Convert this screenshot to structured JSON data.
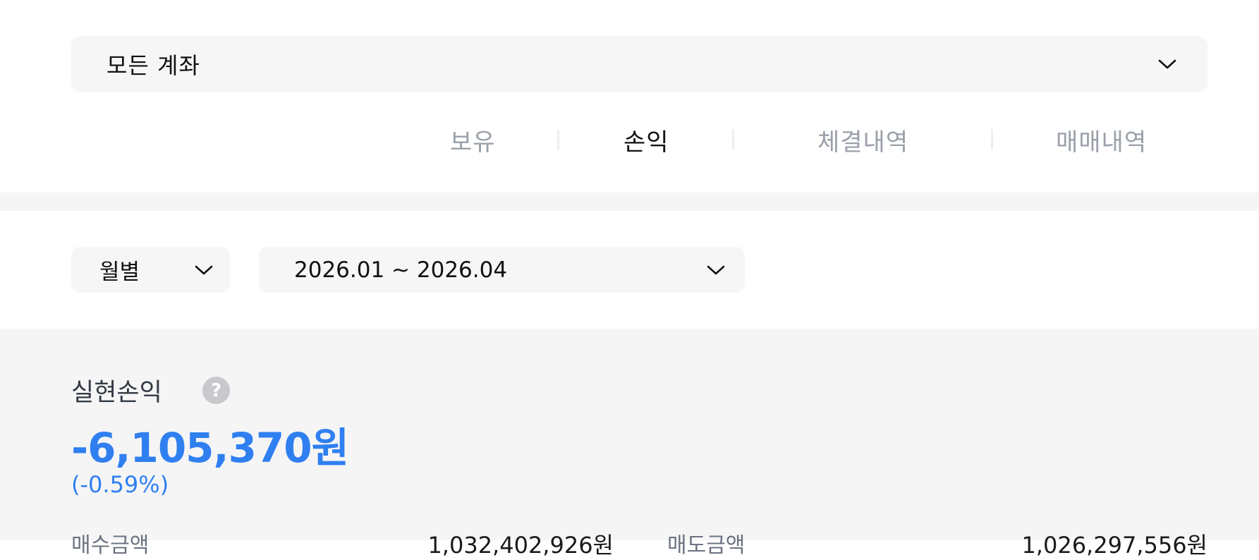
{
  "account": {
    "label": "모든 계좌"
  },
  "tabs": [
    {
      "label": "보유",
      "active": false
    },
    {
      "label": "손익",
      "active": true
    },
    {
      "label": "체결내역",
      "active": false
    },
    {
      "label": "매매내역",
      "active": false
    }
  ],
  "filters": {
    "period": "월별",
    "range": "2026.01 ~ 2026.04"
  },
  "summary": {
    "title": "실현손익",
    "help_icon": "question-icon",
    "amount": "-6,105,370원",
    "rate": "(-0.59%)",
    "buy_label": "매수금액",
    "buy_value": "1,032,402,926원",
    "sell_label": "매도금액",
    "sell_value": "1,026,297,556원"
  },
  "colors": {
    "accent_blue": "#2f7ff0",
    "inactive_tab": "#9aa0a8",
    "panel_bg": "#f6f6f7"
  }
}
